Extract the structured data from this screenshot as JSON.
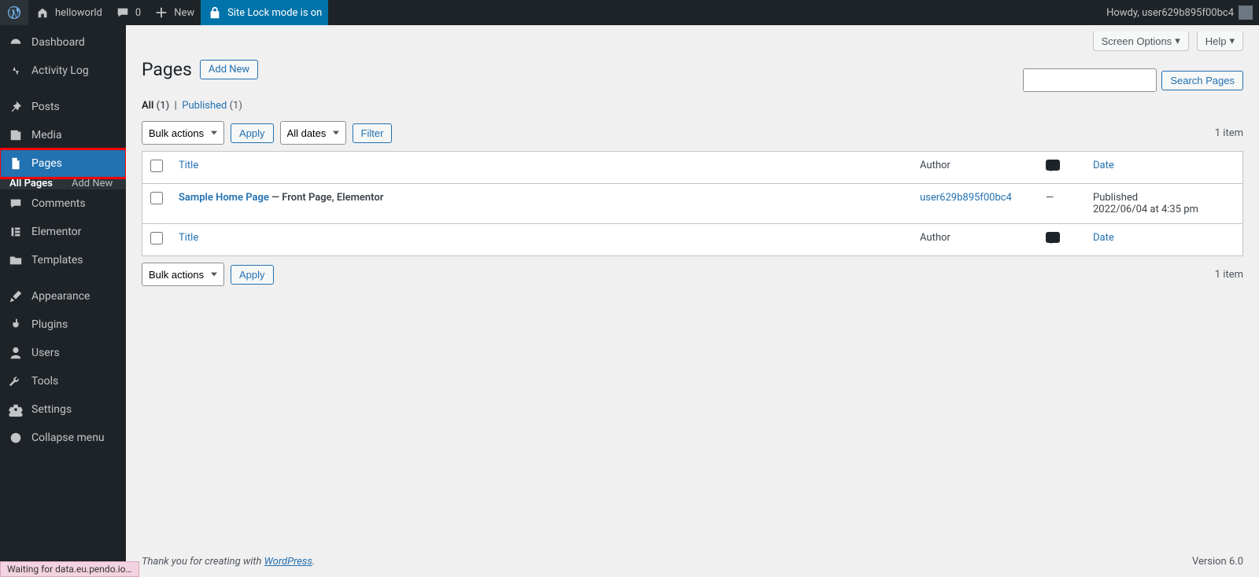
{
  "toolbar": {
    "site_name": "helloworld",
    "comment_count": "0",
    "new_label": "New",
    "sitelock_label": "Site Lock mode is on",
    "howdy_prefix": "Howdy, ",
    "howdy_user": "user629b895f00bc4"
  },
  "sidebar": {
    "items": [
      {
        "label": "Dashboard",
        "icon": "dashboard"
      },
      {
        "label": "Activity Log",
        "icon": "activity"
      },
      {
        "label": "Posts",
        "icon": "pin"
      },
      {
        "label": "Media",
        "icon": "media"
      },
      {
        "label": "Pages",
        "icon": "page",
        "current": true,
        "highlighted": true
      },
      {
        "label": "Comments",
        "icon": "comment"
      },
      {
        "label": "Elementor",
        "icon": "elementor"
      },
      {
        "label": "Templates",
        "icon": "folder"
      },
      {
        "label": "Appearance",
        "icon": "brush"
      },
      {
        "label": "Plugins",
        "icon": "plug"
      },
      {
        "label": "Users",
        "icon": "user"
      },
      {
        "label": "Tools",
        "icon": "wrench"
      },
      {
        "label": "Settings",
        "icon": "settings"
      },
      {
        "label": "Collapse menu",
        "icon": "collapse"
      }
    ],
    "submenu": [
      {
        "label": "All Pages",
        "current": true
      },
      {
        "label": "Add New"
      }
    ]
  },
  "tabs": {
    "screen_options": "Screen Options",
    "help": "Help"
  },
  "heading": "Pages",
  "add_new": "Add New",
  "subsub": {
    "all_label": "All",
    "all_count": "(1)",
    "sep": "|",
    "published_label": "Published",
    "published_count": "(1)"
  },
  "bulk": {
    "label": "Bulk actions",
    "apply": "Apply"
  },
  "date_filter": {
    "label": "All dates",
    "filter": "Filter"
  },
  "search": {
    "button": "Search Pages"
  },
  "count_label": "1 item",
  "columns": {
    "title": "Title",
    "author": "Author",
    "date": "Date"
  },
  "rows": [
    {
      "title": "Sample Home Page",
      "states": " — Front Page, Elementor",
      "author": "user629b895f00bc4",
      "comments": "—",
      "date_status": "Published",
      "date_value": "2022/06/04 at 4:35 pm"
    }
  ],
  "footer": {
    "thank_prefix": "Thank you for creating with ",
    "wp": "WordPress",
    "thank_suffix": ".",
    "version": "Version 6.0"
  },
  "status_bar": "Waiting for data.eu.pendo.io…"
}
